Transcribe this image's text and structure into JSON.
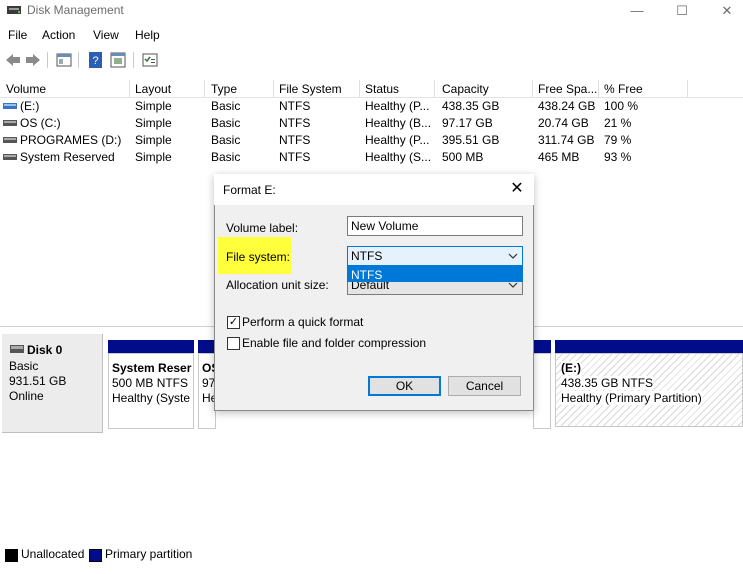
{
  "window": {
    "title": "Disk Management",
    "minimize_glyph": "—",
    "maximize_glyph": "☐",
    "close_glyph": "✕"
  },
  "menu": [
    "File",
    "Action",
    "View",
    "Help"
  ],
  "toolbar": {
    "buttons": [
      "back-icon",
      "forward-icon",
      "properties-icon",
      "help-icon",
      "help-topic-icon",
      "console-icon"
    ]
  },
  "volume_table": {
    "columns": [
      "Volume",
      "Layout",
      "Type",
      "File System",
      "Status",
      "Capacity",
      "Free Spa...",
      "% Free"
    ],
    "rows": [
      {
        "volume": "(E:)",
        "layout": "Simple",
        "type": "Basic",
        "fs": "NTFS",
        "status": "Healthy (P...",
        "capacity": "438.35 GB",
        "free": "438.24 GB",
        "pct": "100 %"
      },
      {
        "volume": "OS (C:)",
        "layout": "Simple",
        "type": "Basic",
        "fs": "NTFS",
        "status": "Healthy (B...",
        "capacity": "97.17 GB",
        "free": "20.74 GB",
        "pct": "21 %"
      },
      {
        "volume": "PROGRAMES (D:)",
        "layout": "Simple",
        "type": "Basic",
        "fs": "NTFS",
        "status": "Healthy (P...",
        "capacity": "395.51 GB",
        "free": "311.74 GB",
        "pct": "79 %"
      },
      {
        "volume": "System Reserved",
        "layout": "Simple",
        "type": "Basic",
        "fs": "NTFS",
        "status": "Healthy (S...",
        "capacity": "500 MB",
        "free": "465 MB",
        "pct": "93 %"
      }
    ]
  },
  "disk": {
    "name": "Disk 0",
    "type": "Basic",
    "size": "931.51 GB",
    "state": "Online",
    "partitions": [
      {
        "name": "System Reser",
        "size": "500 MB NTFS",
        "status": "Healthy (Syste"
      },
      {
        "name": "OS",
        "size": "97",
        "status": "He"
      },
      {
        "name": "(E:)",
        "size": "438.35 GB NTFS",
        "status": "Healthy (Primary Partition)"
      }
    ]
  },
  "legend": {
    "unallocated": "Unallocated",
    "primary": "Primary partition",
    "primary_color": "#000c8a"
  },
  "dialog": {
    "title": "Format E:",
    "close_glyph": "✕",
    "volume_label_label": "Volume label:",
    "volume_label_value": "New Volume",
    "file_system_label": "File system:",
    "file_system_value": "NTFS",
    "file_system_option": "NTFS",
    "allocation_label": "Allocation unit size:",
    "allocation_value": "Default",
    "quick_format_label": "Perform a quick format",
    "quick_format_checked": true,
    "compression_label": "Enable file and folder compression",
    "compression_checked": false,
    "ok_label": "OK",
    "cancel_label": "Cancel",
    "highlight_color": "#ffff3b",
    "accent_color": "#0078d7"
  }
}
